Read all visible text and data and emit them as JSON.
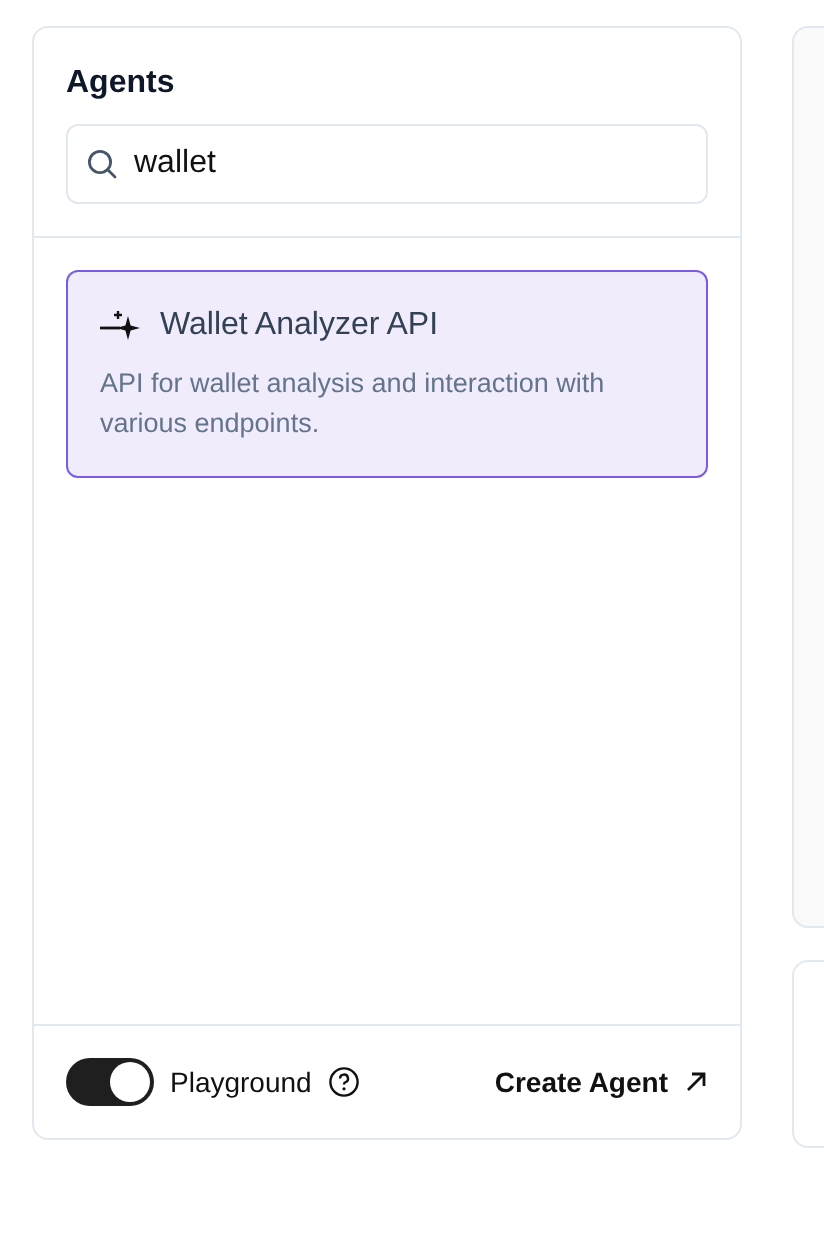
{
  "sidebar": {
    "title": "Agents",
    "search": {
      "value": "wallet"
    },
    "agents": [
      {
        "name": "Wallet Analyzer API",
        "description": "API for wallet analysis and interaction with various endpoints.",
        "selected": true
      }
    ],
    "footer": {
      "playground": {
        "label": "Playground",
        "on": true
      },
      "create_button": "Create Agent"
    }
  }
}
